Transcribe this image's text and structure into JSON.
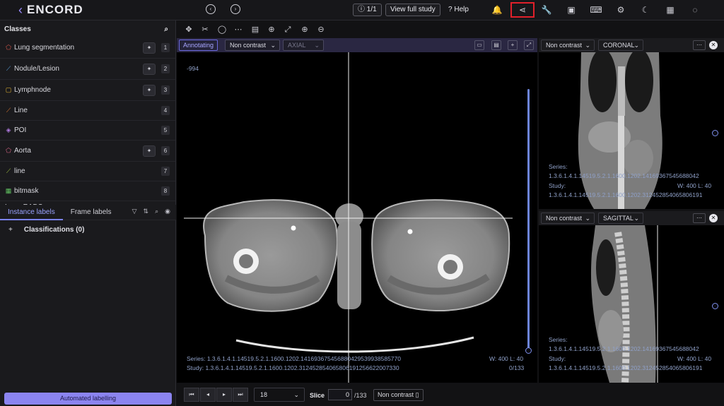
{
  "app": {
    "name": "ENCORD"
  },
  "topbar": {
    "frame_counter": "1/1",
    "view_full_study": "View full study",
    "help": "Help"
  },
  "sidebar": {
    "title": "Classes",
    "classes": [
      {
        "label": "Lung segmentation",
        "key": "1",
        "color": "#e05a4e",
        "icon": "polygon-icon",
        "wand": true
      },
      {
        "label": "Nodule/Lesion",
        "key": "2",
        "color": "#5aa0e0",
        "icon": "polyline-icon",
        "wand": true
      },
      {
        "label": "Lymphnode",
        "key": "3",
        "color": "#e0b030",
        "icon": "bounding-box-icon",
        "wand": true
      },
      {
        "label": "Line",
        "key": "4",
        "color": "#e07a30",
        "icon": "polyline-icon",
        "wand": false
      },
      {
        "label": "POI",
        "key": "5",
        "color": "#b07ae0",
        "icon": "point-icon",
        "wand": false
      },
      {
        "label": "Aorta",
        "key": "6",
        "color": "#e06a8a",
        "icon": "polygon-icon",
        "wand": true
      },
      {
        "label": "line",
        "key": "7",
        "color": "#a0c040",
        "icon": "polyline-icon",
        "wand": false
      },
      {
        "label": "bitmask",
        "key": "8",
        "color": "#60c060",
        "icon": "bitmask-icon",
        "wand": false
      }
    ],
    "partial_class": "Lung-RADS",
    "tabs": {
      "instance": "Instance labels",
      "frame": "Frame labels"
    },
    "classifications": "Classifications (0)",
    "automated": "Automated labelling"
  },
  "main_viewport": {
    "mode_badge": "Annotating",
    "contrast": "Non contrast",
    "plane": "AXIAL",
    "value_readout": "-994",
    "series": "Series: 1.3.6.1.4.1.14519.5.2.1.1600.1202.141693675456880429539938585770",
    "study": "Study: 1.3.6.1.4.1.14519.5.2.1.1600.1202.312452854065806191256622007330",
    "window": "W: 400 L: 40",
    "slice_counter": "0/133"
  },
  "coronal_viewport": {
    "contrast": "Non contrast",
    "plane": "CORONAL",
    "series_label": "Series:",
    "series": "1.3.6.1.4.1.14519.5.2.1.1600.1202.14169367545688042",
    "study_label": "Study:",
    "study": "1.3.6.1.4.1.14519.5.2.1.1600.1202.312452854065806191",
    "window": "W: 400 L: 40"
  },
  "sagittal_viewport": {
    "contrast": "Non contrast",
    "plane": "SAGITTAL",
    "series_label": "Series:",
    "series": "1.3.6.1.4.1.14519.5.2.1.1600.1202.14169367545688042",
    "study_label": "Study:",
    "study": "1.3.6.1.4.1.14519.5.2.1.1600.1202.312452854065806191",
    "window": "W: 400 L: 40"
  },
  "bottom": {
    "fps": "18",
    "slice_label": "Slice",
    "slice_value": "0",
    "slice_total": "/133",
    "contrast": "Non contrast"
  }
}
